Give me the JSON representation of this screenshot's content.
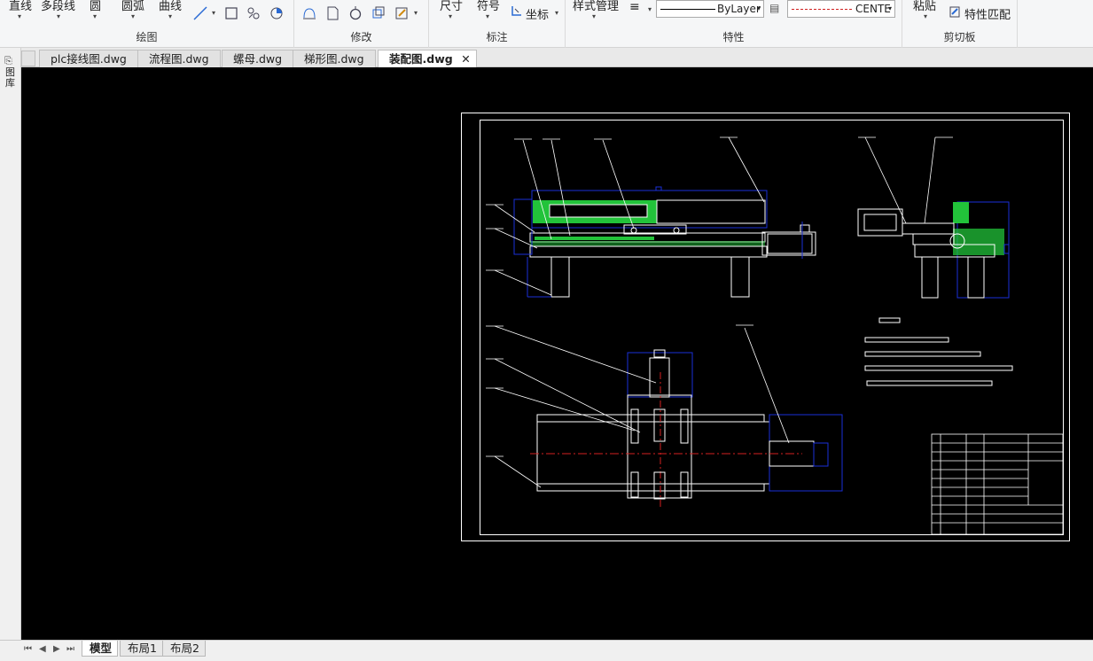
{
  "ribbon": {
    "draw": {
      "line": "直线",
      "polyline": "多段线",
      "circle": "圆",
      "arc": "圆弧",
      "curve": "曲线",
      "group_label": "绘图"
    },
    "modify": {
      "group_label": "修改"
    },
    "annotate": {
      "dimension": "尺寸",
      "symbol": "符号",
      "coordinate": "坐标",
      "group_label": "标注"
    },
    "properties": {
      "style_manager": "样式管理",
      "lineweight_value": "ByLayer",
      "linetype_value": "CENTE",
      "group_label": "特性"
    },
    "clipboard": {
      "paste": "粘贴",
      "match_properties": "特性匹配",
      "group_label": "剪切板"
    }
  },
  "tabs": [
    {
      "label": "plc接线图.dwg"
    },
    {
      "label": "流程图.dwg"
    },
    {
      "label": "螺母.dwg"
    },
    {
      "label": "梯形图.dwg"
    },
    {
      "label": "装配图.dwg"
    }
  ],
  "leftbar": {
    "label": "图库"
  },
  "bottom_tabs": [
    {
      "label": "模型"
    },
    {
      "label": "布局1"
    },
    {
      "label": "布局2"
    }
  ],
  "colors": {
    "canvas": "#000000",
    "drawing_lines": "#ffffff",
    "section_fill": "#22c33a",
    "dim_lines": "#1a2fd8",
    "center_lines": "#d42020"
  }
}
